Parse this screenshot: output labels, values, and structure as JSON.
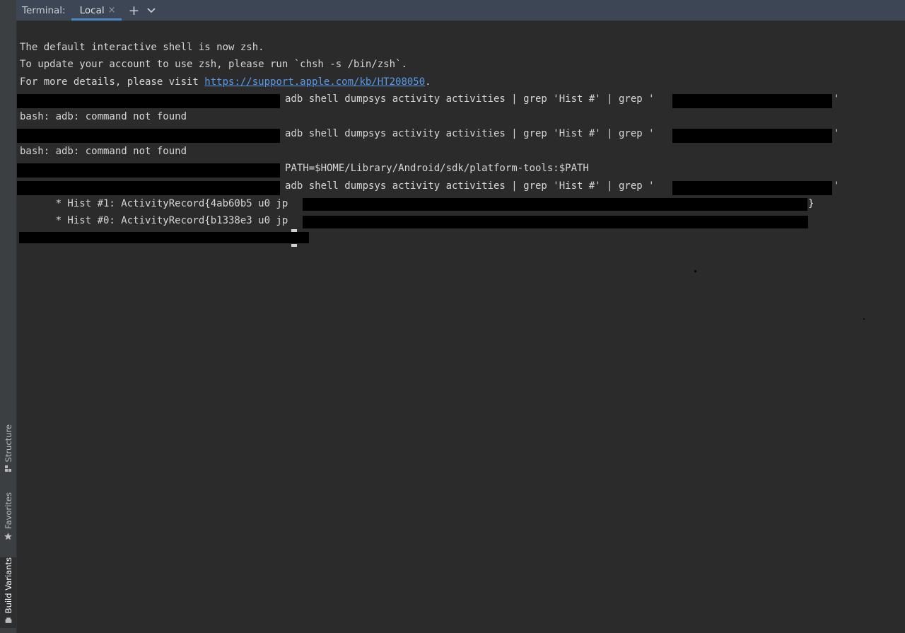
{
  "sidebar": {
    "tabs": [
      {
        "label": "Structure",
        "icon": "structure-icon"
      },
      {
        "label": "Favorites",
        "icon": "star-icon"
      },
      {
        "label": "Build Variants",
        "icon": "android-icon"
      }
    ]
  },
  "tabbar": {
    "title": "Terminal:",
    "tab_label": "Local",
    "close_glyph": "×",
    "add_glyph": "+"
  },
  "terminal": {
    "lines": [
      "The default interactive shell is now zsh.",
      "To update your account to use zsh, please run `chsh -s /bin/zsh`.",
      "For more details, please visit ",
      "adb shell dumpsys activity activities | grep 'Hist #' | grep '",
      "bash: adb: command not found",
      "adb shell dumpsys activity activities | grep 'Hist #' | grep '",
      "bash: adb: command not found",
      "PATH=$HOME/Library/Android/sdk/platform-tools:$PATH",
      "adb shell dumpsys activity activities | grep 'Hist #' | grep '",
      "      * Hist #1: ActivityRecord{4ab60b5 u0 jp",
      "      * Hist #0: ActivityRecord{b1338e3 u0 jp"
    ],
    "link": "https://support.apple.com/kb/HT208050",
    "link_suffix": ".",
    "quote_close": "'",
    "brace_close": "}"
  },
  "colors": {
    "background": "#2b2b2b",
    "tabbar": "#3c4654",
    "accent": "#4a88c7",
    "link": "#5a9ae6"
  }
}
